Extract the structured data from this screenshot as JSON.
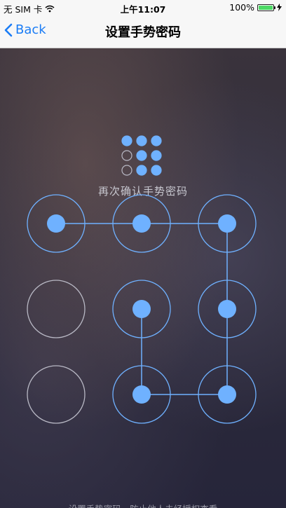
{
  "status_bar": {
    "carrier": "无 SIM 卡",
    "time": "上午11:07",
    "battery": "100%",
    "battery_level": 1.0
  },
  "nav": {
    "back_label": "Back",
    "title": "设置手势密码"
  },
  "prompt": "再次确认手势密码",
  "footer": "设置手势密码，防止他人未经授权查看",
  "colors": {
    "accent": "#6fb1ff",
    "ring_inactive": "#b8b8c4",
    "nav_blue": "#1a7cf5"
  },
  "mini_pattern": [
    true,
    true,
    true,
    false,
    true,
    true,
    false,
    true,
    true
  ],
  "pattern": {
    "selected": [
      true,
      true,
      true,
      false,
      true,
      true,
      false,
      true,
      true
    ],
    "path": [
      0,
      1,
      2,
      5,
      8,
      7,
      4
    ]
  }
}
